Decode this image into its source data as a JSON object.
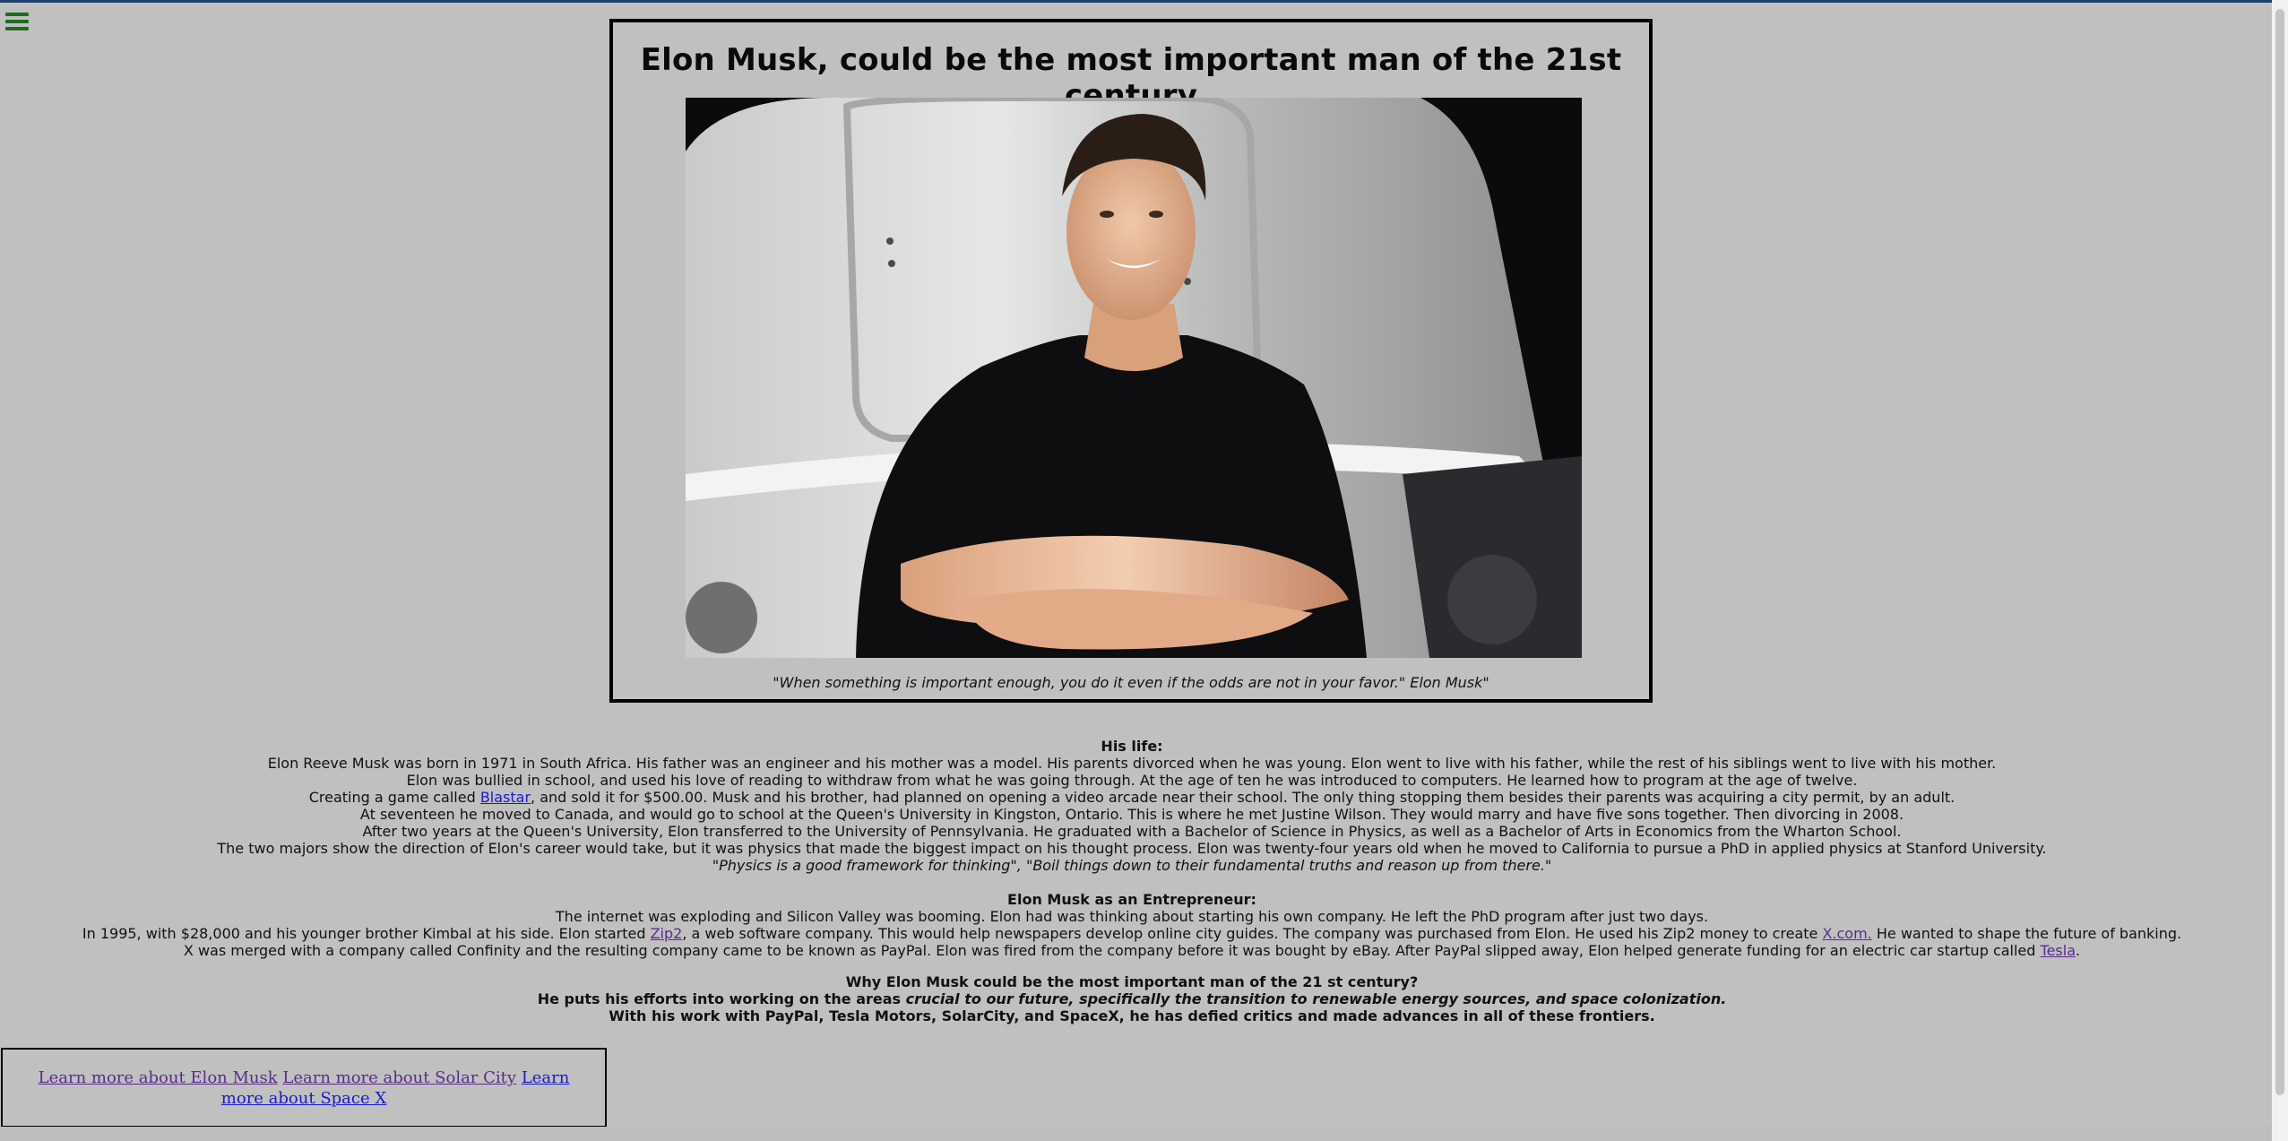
{
  "nav": {
    "menu_icon": "hamburger-menu-icon"
  },
  "hero": {
    "title": "Elon Musk, could be the most important man of the 21st century",
    "image_alt": "Elon Musk photo",
    "quote": "\"When something is important enough, you do it even if the odds are not in your favor.\" Elon Musk\""
  },
  "life": {
    "heading": "His life:",
    "p1": "Elon Reeve Musk was born in 1971 in South Africa. His father was an engineer and his mother was a model. His parents divorced when he was young. Elon went to live with his father, while the rest of his siblings went to live with his mother.",
    "p2": "Elon was bullied in school, and used his love of reading to withdraw from what he was going through. At the age of ten he was introduced to computers. He learned how to program at the age of twelve.",
    "p3_before": "Creating a game called ",
    "p3_link": "Blastar",
    "p3_after": ", and sold it for $500.00. Musk and his brother, had planned on opening a video arcade near their school. The only thing stopping them besides their parents was acquiring a city permit, by an adult.",
    "p4": "At seventeen he moved to Canada, and would go to school at the Queen's University in Kingston, Ontario. This is where he met Justine Wilson. They would marry and have five sons together. Then divorcing in 2008.",
    "p5": "After two years at the Queen's University, Elon transferred to the University of Pennsylvania. He graduated with a Bachelor of Science in Physics, as well as a Bachelor of Arts in Economics from the Wharton School.",
    "p6": "The two majors show the direction of Elon's career would take, but it was physics that made the biggest impact on his thought process. Elon was twenty-four years old when he moved to California to pursue a PhD in applied physics at Stanford University.",
    "p7": "\"Physics is a good framework for thinking\", \"Boil things down to their fundamental truths and reason up from there.\""
  },
  "entrepreneur": {
    "heading": "Elon Musk as an Entrepreneur:",
    "p1": "The internet was exploding and Silicon Valley was booming. Elon had was thinking about starting his own company. He left the PhD program after just two days.",
    "p2_a": "In 1995, with $28,000 and his younger brother Kimbal at his side. Elon started ",
    "p2_link1": "Zip2",
    "p2_b": ", a web software company. This would help newspapers develop online city guides. The company was purchased from Elon. He used his Zip2 money to create ",
    "p2_link2": "X.com.",
    "p2_c": " He wanted to shape the future of banking.",
    "p3_a": "X was merged with a company called Confinity and the resulting company came to be known as PayPal. Elon was fired from the company before it was bought by eBay. After PayPal slipped away, Elon helped generate funding for an electric car startup called ",
    "p3_link": "Tesla",
    "p3_b": "."
  },
  "why": {
    "heading": "Why Elon Musk could be the most important man of the 21 st century?",
    "p1_a": "He puts his efforts into working on the areas ",
    "p1_em": "crucial to our future, specifically the transition to renewable energy sources, and space colonization.",
    "p2": "With his work with PayPal, Tesla Motors, SolarCity, and SpaceX, he has defied critics and made advances in all of these frontiers."
  },
  "footer": {
    "link1": "Learn more about Elon Musk",
    "link2": "Learn more about Solar City",
    "link3": "Learn more about Space X"
  }
}
